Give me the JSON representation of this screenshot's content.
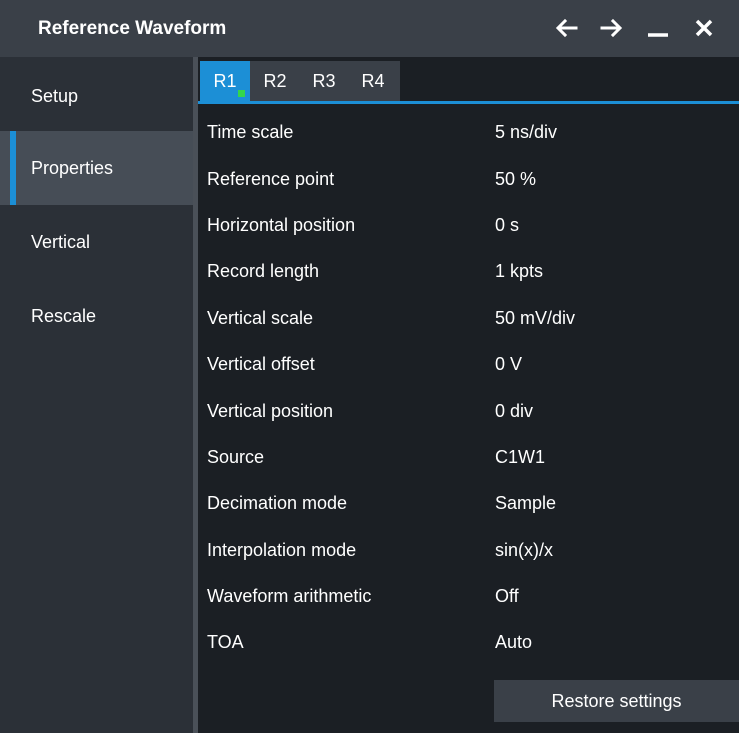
{
  "window": {
    "title": "Reference Waveform"
  },
  "titlebar_icons": [
    "arrow-left-icon",
    "arrow-right-icon",
    "minimize-icon",
    "close-icon"
  ],
  "sidebar": {
    "items": [
      {
        "label": "Setup",
        "active": false
      },
      {
        "label": "Properties",
        "active": true
      },
      {
        "label": "Vertical",
        "active": false
      },
      {
        "label": "Rescale",
        "active": false
      }
    ]
  },
  "tabs": [
    {
      "label": "R1",
      "active": true,
      "indicator": "green"
    },
    {
      "label": "R2",
      "active": false
    },
    {
      "label": "R3",
      "active": false
    },
    {
      "label": "R4",
      "active": false
    }
  ],
  "properties": [
    {
      "label": "Time scale",
      "value": "5 ns/div"
    },
    {
      "label": "Reference point",
      "value": "50 %"
    },
    {
      "label": "Horizontal position",
      "value": "0 s"
    },
    {
      "label": "Record length",
      "value": "1 kpts"
    },
    {
      "label": "Vertical scale",
      "value": "50 mV/div"
    },
    {
      "label": "Vertical offset",
      "value": "0 V"
    },
    {
      "label": "Vertical position",
      "value": "0 div"
    },
    {
      "label": "Source",
      "value": "C1W1"
    },
    {
      "label": "Decimation mode",
      "value": "Sample"
    },
    {
      "label": "Interpolation mode",
      "value": "sin(x)/x"
    },
    {
      "label": "Waveform arithmetic",
      "value": "Off"
    },
    {
      "label": "TOA",
      "value": "Auto"
    }
  ],
  "restore_button": {
    "label": "Restore settings"
  },
  "colors": {
    "accent": "#1c8fd6",
    "indicator": "#34d64a",
    "titlebar": "#3a4048",
    "sidebar": "#2b3037",
    "background": "#1b1f24"
  }
}
